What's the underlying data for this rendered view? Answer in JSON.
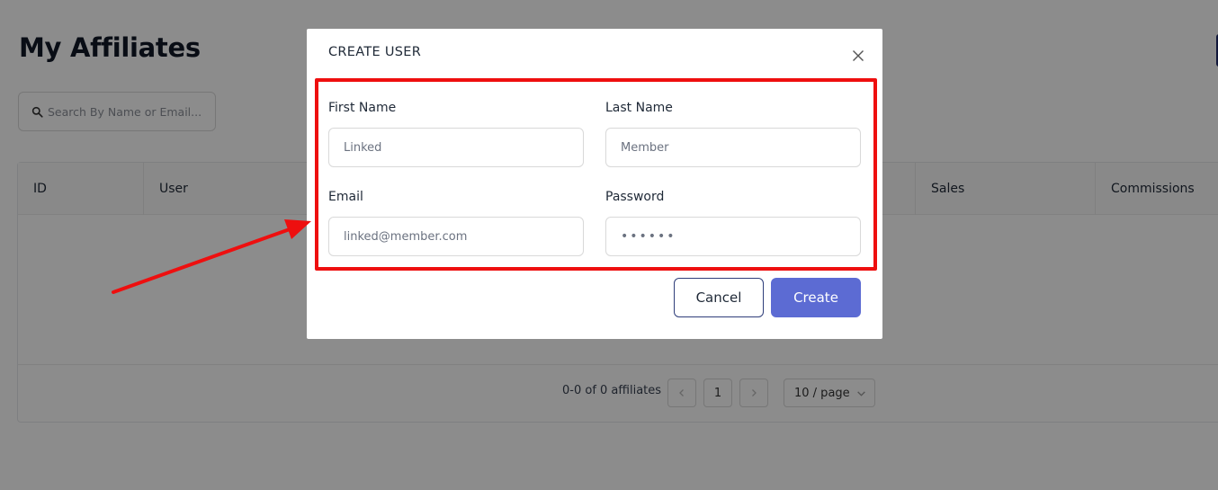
{
  "page": {
    "title": "My Affiliates",
    "search_placeholder": "Search By Name or Email..."
  },
  "table": {
    "columns": [
      "ID",
      "User",
      "Sales",
      "Commissions"
    ],
    "pagination": {
      "summary": "0-0 of 0 affiliates",
      "current_page": "1",
      "page_size": "10 / page",
      "prev_icon": "chevron-left-icon",
      "next_icon": "chevron-right-icon"
    }
  },
  "modal": {
    "title": "CREATE USER",
    "fields": {
      "first_name": {
        "label": "First Name",
        "placeholder": "Linked"
      },
      "last_name": {
        "label": "Last Name",
        "placeholder": "Member"
      },
      "email": {
        "label": "Email",
        "placeholder": "linked@member.com"
      },
      "password": {
        "label": "Password",
        "value": "••••••"
      }
    },
    "buttons": {
      "cancel": "Cancel",
      "create": "Create"
    }
  },
  "colors": {
    "primary": "#5c6bd3",
    "annotation": "#ee0f0f",
    "outline_button_border": "#2f3e7a"
  }
}
